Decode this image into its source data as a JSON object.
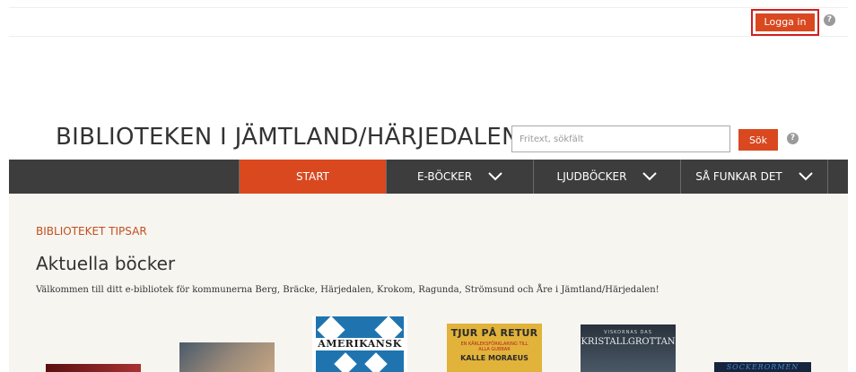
{
  "header": {
    "login_label": "Logga in",
    "help_glyph": "?"
  },
  "site": {
    "title": "BIBLIOTEKEN I JÄMTLAND/HÄRJEDALEN"
  },
  "search": {
    "placeholder": "Fritext, sökfält",
    "button_label": "Sök"
  },
  "nav": {
    "items": [
      {
        "label": "START"
      },
      {
        "label": "E-BÖCKER"
      },
      {
        "label": "LJUDBÖCKER"
      },
      {
        "label": "SÅ FUNKAR DET"
      }
    ]
  },
  "section": {
    "eyebrow": "BIBLIOTEKET TIPSAR",
    "heading": "Aktuella böcker",
    "intro": "Välkommen till ditt e-bibliotek för kommunerna Berg, Bräcke, Härjedalen, Krokom, Ragunda, Strömsund och Åre i Jämtland/Härjedalen!"
  },
  "books": [
    {
      "title_text": ""
    },
    {
      "title_text": ""
    },
    {
      "title_text": "AMERIKANSK"
    },
    {
      "title_text": "TJUR PÅ RETUR",
      "subtitle_text": "EN KÄRLEKSFÖRKLARING TILL ALLA GUBBAR",
      "author_text": "KALLE MORAEUS"
    },
    {
      "title_text": "KRISTALLGROTTAN",
      "kicker_text": "VISKORNAS DAS"
    },
    {
      "title_text": "SOCKERORMEN"
    }
  ],
  "colors": {
    "accent": "#d9481f",
    "nav_bg": "#3d3d3d",
    "content_bg": "#f7f5f0",
    "login_outline": "#d21f1f"
  }
}
